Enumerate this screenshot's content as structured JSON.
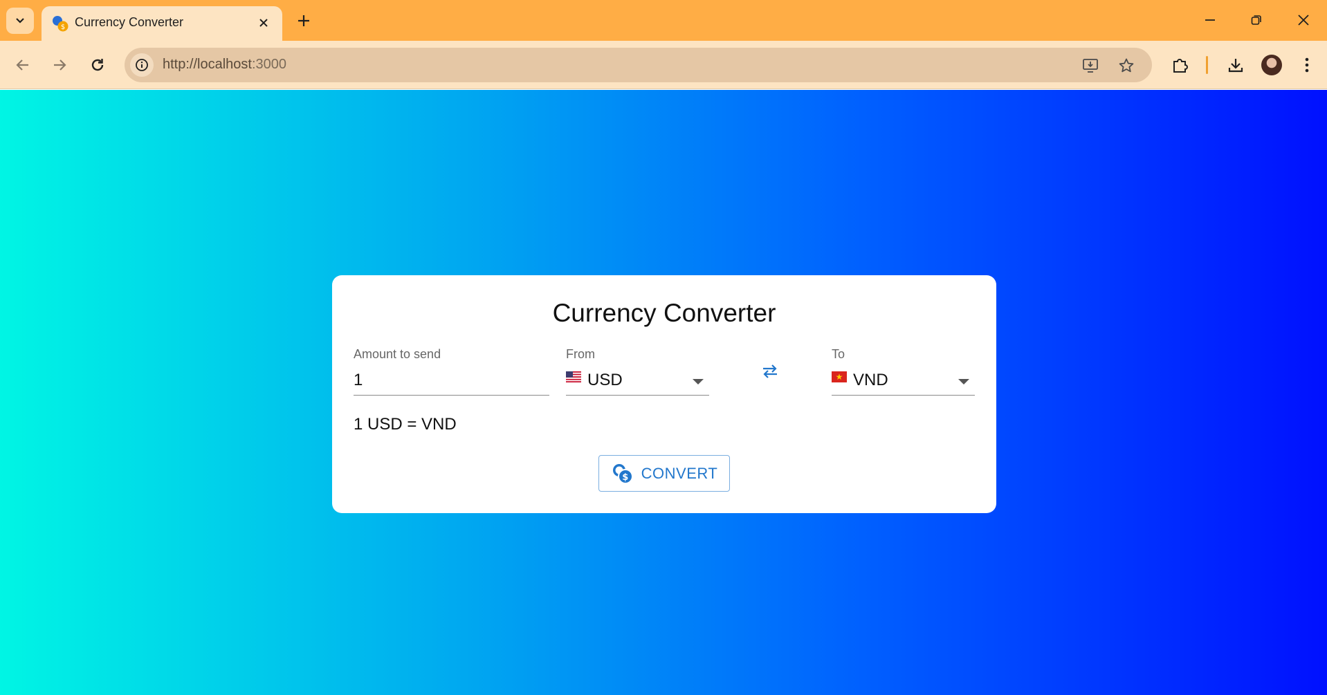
{
  "browser": {
    "tab_title": "Currency Converter",
    "url_host": "http://localhost",
    "url_port": ":3000"
  },
  "colors": {
    "titlebar": "#ffad45",
    "toolbar": "#fde4c2",
    "accent": "#2277cc",
    "gradient_start": "#00f5e4",
    "gradient_end": "#0010ff"
  },
  "converter": {
    "title": "Currency Converter",
    "amount_label": "Amount to send",
    "amount_value": "1",
    "from_label": "From",
    "from_value": "USD",
    "from_flag": "us-flag",
    "to_label": "To",
    "to_value": "VND",
    "to_flag": "vn-flag",
    "swap_icon": "swap-arrows-icon",
    "result_text": "1 USD = VND",
    "convert_label": "CONVERT",
    "convert_icon": "currency-exchange-icon"
  }
}
